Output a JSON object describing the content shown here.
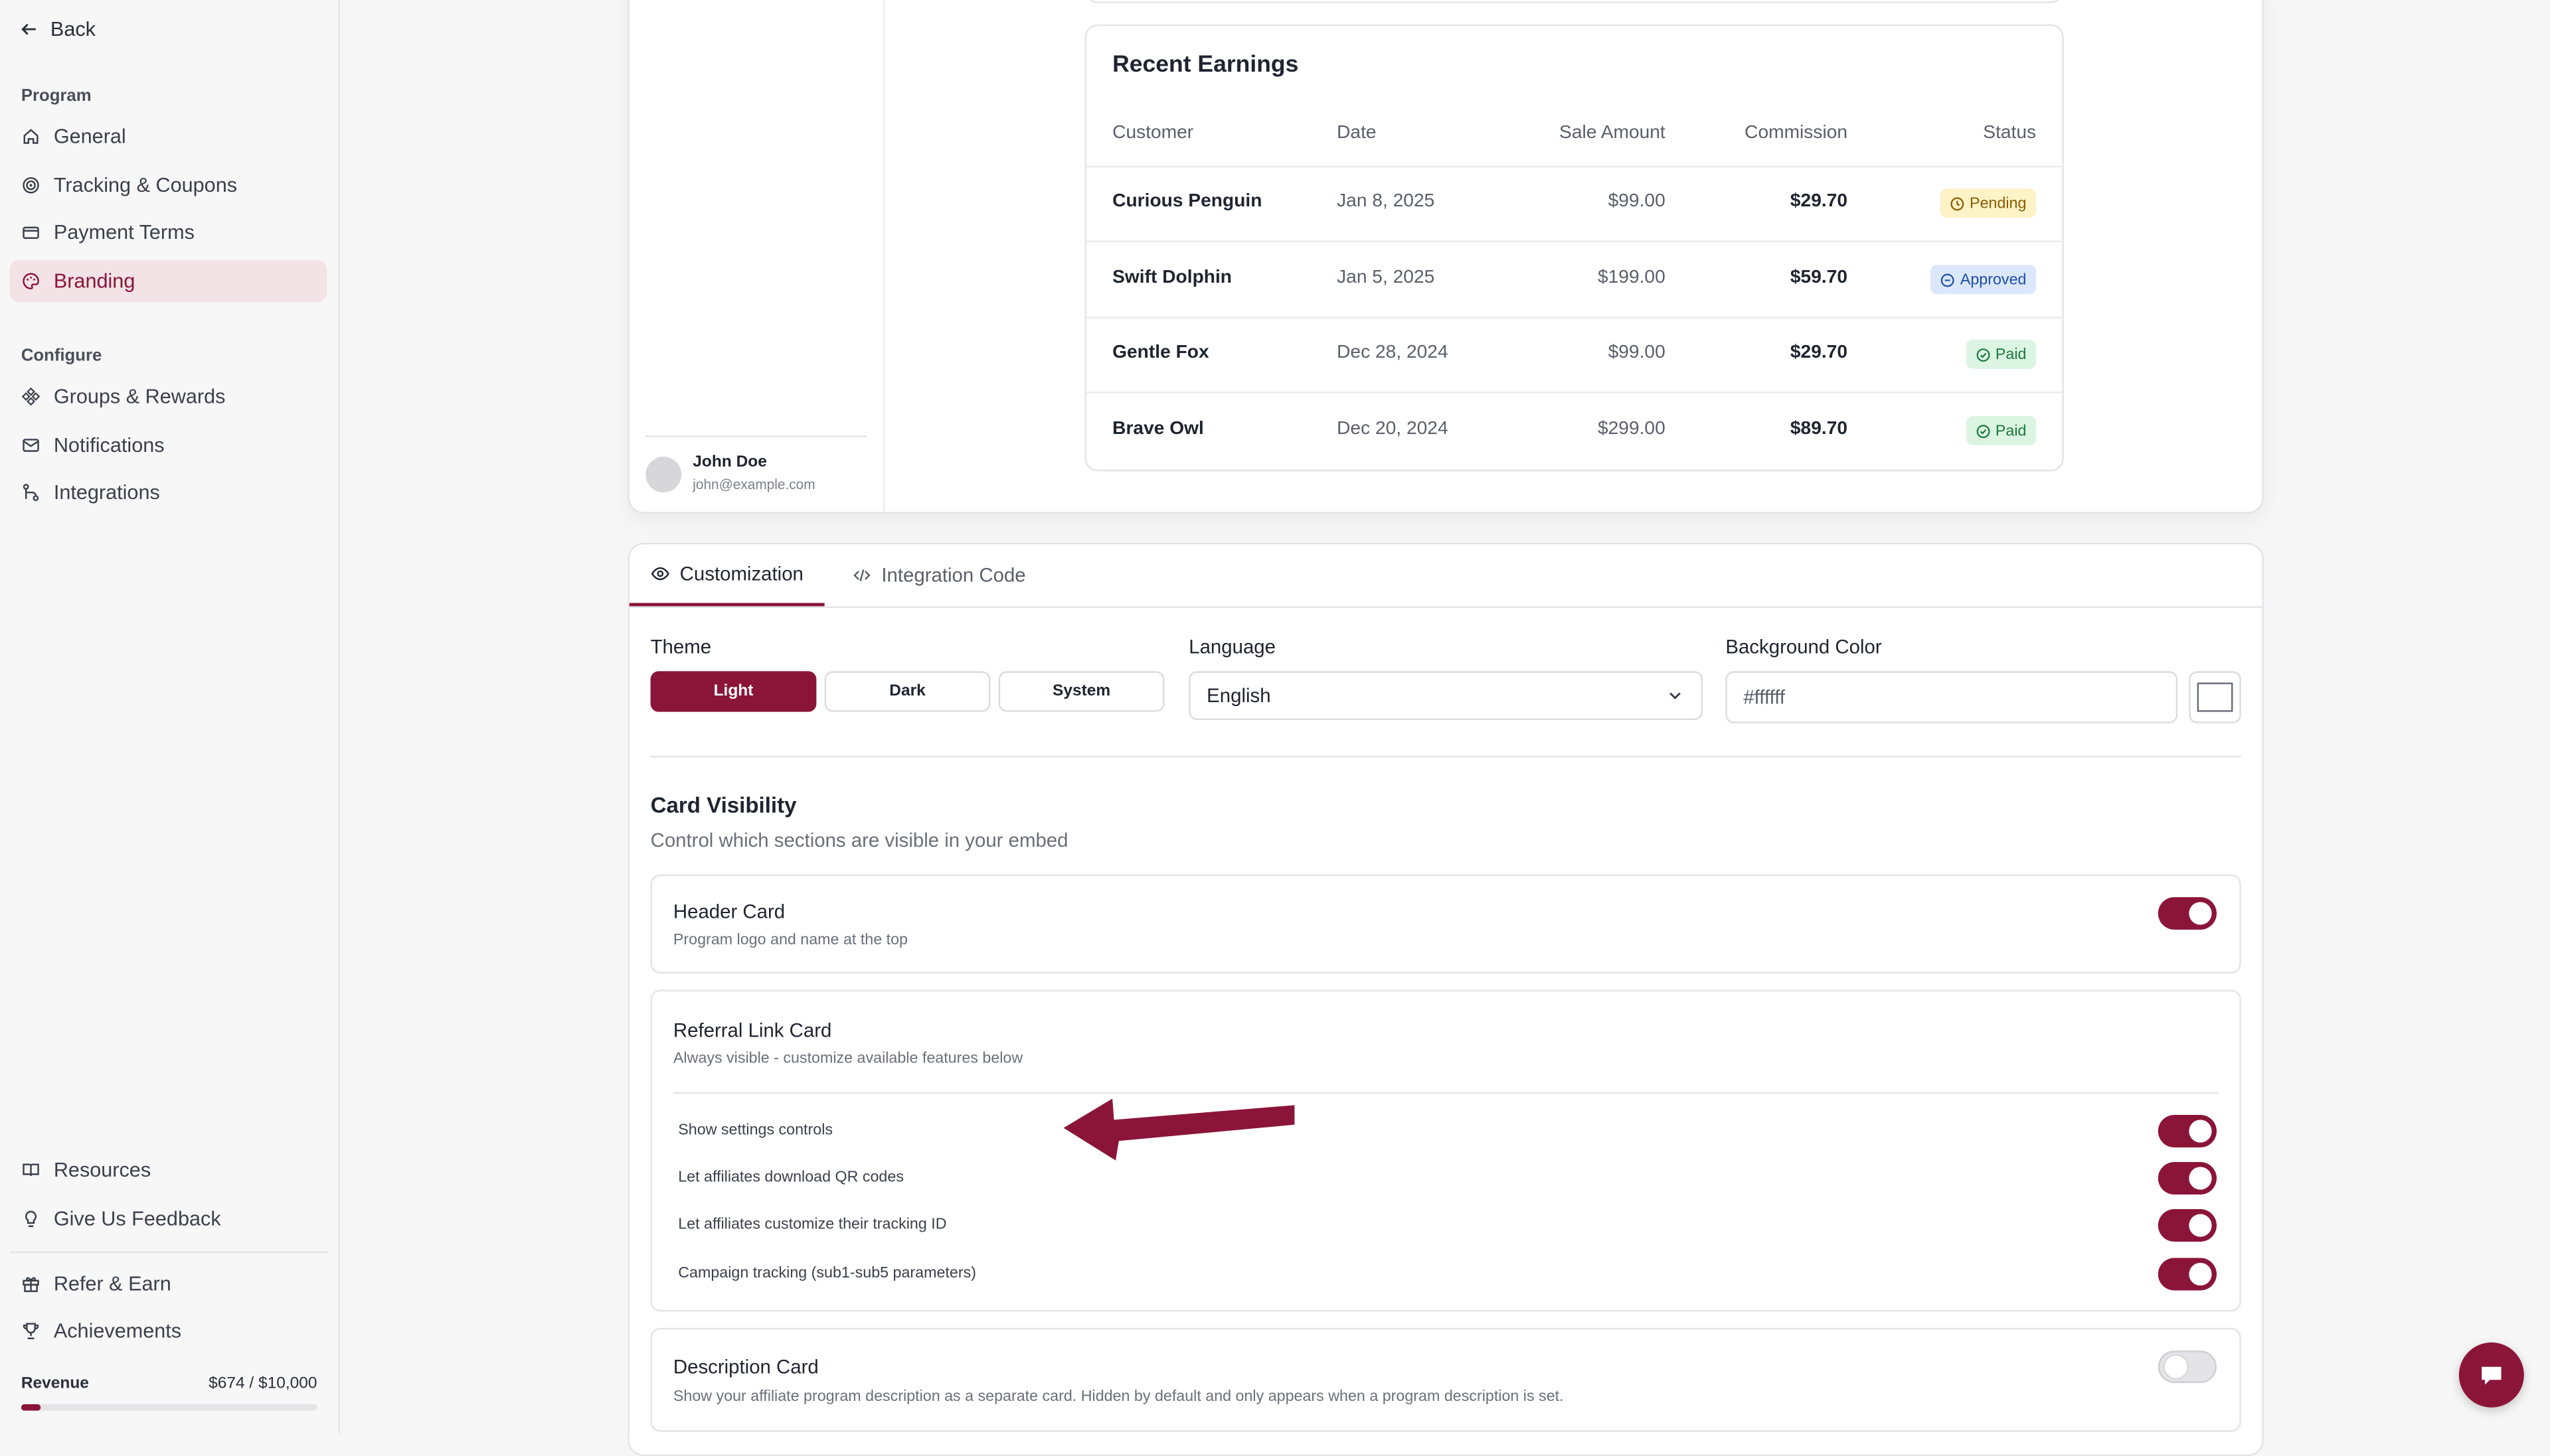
{
  "sidebar": {
    "back": "Back",
    "program_label": "Program",
    "program_items": [
      {
        "label": "General"
      },
      {
        "label": "Tracking & Coupons"
      },
      {
        "label": "Payment Terms"
      },
      {
        "label": "Branding"
      }
    ],
    "configure_label": "Configure",
    "configure_items": [
      {
        "label": "Groups & Rewards"
      },
      {
        "label": "Notifications"
      },
      {
        "label": "Integrations"
      }
    ],
    "footer_items": [
      {
        "label": "Resources"
      },
      {
        "label": "Give Us Feedback"
      },
      {
        "label": "Refer & Earn"
      },
      {
        "label": "Achievements"
      }
    ],
    "revenue": {
      "label": "Revenue",
      "value": "$674 / $10,000",
      "progress": 0.0674
    }
  },
  "preview": {
    "user": {
      "name": "John Doe",
      "email": "john@example.com"
    },
    "earnings": {
      "title": "Recent Earnings",
      "columns": [
        "Customer",
        "Date",
        "Sale Amount",
        "Commission",
        "Status"
      ],
      "rows": [
        {
          "customer": "Curious Penguin",
          "date": "Jan 8, 2025",
          "sale": "$99.00",
          "commission": "$29.70",
          "status": "Pending"
        },
        {
          "customer": "Swift Dolphin",
          "date": "Jan 5, 2025",
          "sale": "$199.00",
          "commission": "$59.70",
          "status": "Approved"
        },
        {
          "customer": "Gentle Fox",
          "date": "Dec 28, 2024",
          "sale": "$99.00",
          "commission": "$29.70",
          "status": "Paid"
        },
        {
          "customer": "Brave Owl",
          "date": "Dec 20, 2024",
          "sale": "$299.00",
          "commission": "$89.70",
          "status": "Paid"
        }
      ]
    }
  },
  "customization": {
    "tabs": [
      "Customization",
      "Integration Code"
    ],
    "theme": {
      "label": "Theme",
      "options": [
        "Light",
        "Dark",
        "System"
      ],
      "selected": "Light"
    },
    "language": {
      "label": "Language",
      "value": "English"
    },
    "background": {
      "label": "Background Color",
      "value": "#ffffff"
    },
    "card_visibility": {
      "title": "Card Visibility",
      "subtitle": "Control which sections are visible in your embed",
      "header_card": {
        "title": "Header Card",
        "subtitle": "Program logo and name at the top",
        "enabled": true
      },
      "referral_card": {
        "title": "Referral Link Card",
        "subtitle": "Always visible - customize available features below",
        "options": [
          {
            "label": "Show settings controls",
            "enabled": true
          },
          {
            "label": "Let affiliates download QR codes",
            "enabled": true
          },
          {
            "label": "Let affiliates customize their tracking ID",
            "enabled": true
          },
          {
            "label": "Campaign tracking (sub1-sub5 parameters)",
            "enabled": true
          }
        ]
      },
      "description_card": {
        "title": "Description Card",
        "subtitle": "Show your affiliate program description as a separate card. Hidden by default and only appears when a program description is set.",
        "enabled": false
      }
    }
  },
  "colors": {
    "accent": "#8b1538",
    "pending_bg": "#fdf3c7",
    "approved_bg": "#dbe7fb",
    "paid_bg": "#dcf5e3"
  }
}
